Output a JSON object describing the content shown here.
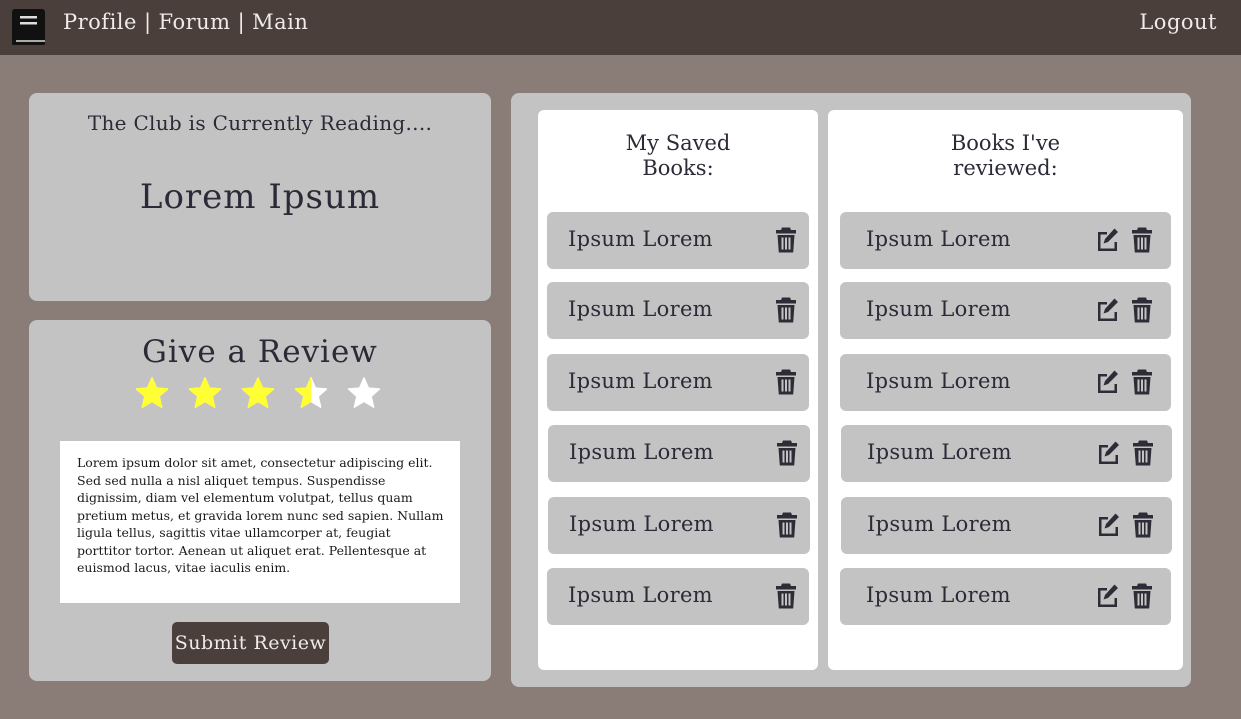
{
  "header": {
    "nav": [
      "Profile",
      "Forum",
      "Main"
    ],
    "separator": "|",
    "logout": "Logout"
  },
  "reading": {
    "heading": "The Club is Currently Reading....",
    "title": "Lorem Ipsum"
  },
  "review": {
    "heading": "Give a Review",
    "rating": 3.5,
    "max_rating": 5,
    "text": "Lorem ipsum dolor sit amet, consectetur adipiscing elit. Sed sed nulla a nisl aliquet tempus. Suspendisse dignissim, diam vel elementum volutpat, tellus quam pretium metus, et gravida lorem nunc sed sapien. Nullam ligula tellus, sagittis vitae ullamcorper at, feugiat porttitor tortor. Aenean ut aliquet erat. Pellentesque at euismod lacus, vitae iaculis enim.",
    "submit_label": "Submit Review"
  },
  "saved": {
    "title_line1": "My Saved",
    "title_line2": "Books:",
    "items": [
      "Ipsum Lorem",
      "Ipsum Lorem",
      "Ipsum Lorem",
      "Ipsum Lorem",
      "Ipsum Lorem",
      "Ipsum Lorem"
    ]
  },
  "reviewed": {
    "title_line1": "Books I've",
    "title_line2": "reviewed:",
    "items": [
      "Ipsum Lorem",
      "Ipsum Lorem",
      "Ipsum Lorem",
      "Ipsum Lorem",
      "Ipsum Lorem",
      "Ipsum Lorem"
    ]
  },
  "colors": {
    "star_filled": "#ffff33",
    "star_empty": "#ffffff",
    "header_bg": "#4a3f3a",
    "page_bg": "#8a7d78",
    "card_bg": "#c4c3c4"
  },
  "icons": {
    "logo": "book-icon",
    "delete": "trash-icon",
    "edit": "edit-icon",
    "star": "star-icon"
  }
}
